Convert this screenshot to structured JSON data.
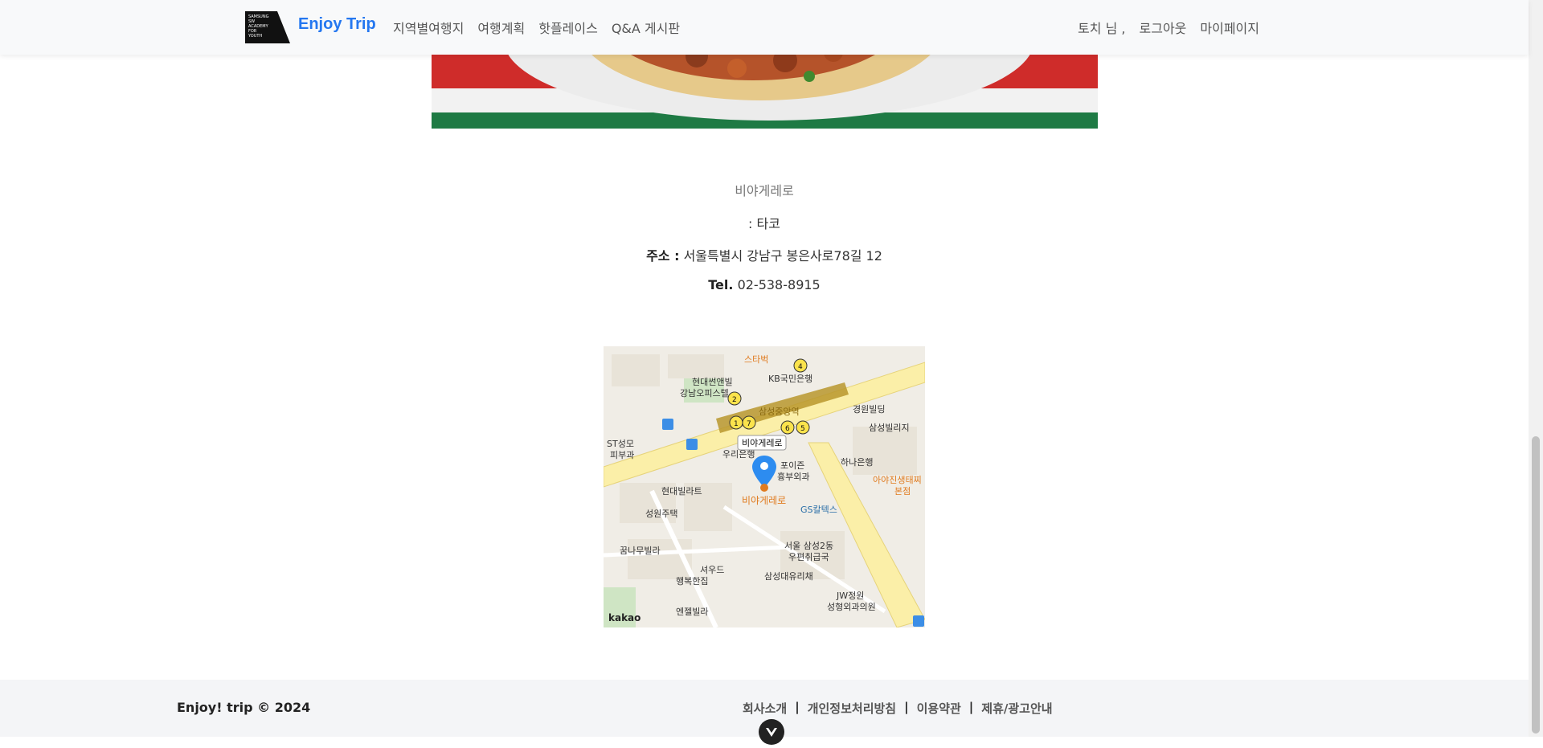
{
  "header": {
    "brand": "Enjoy Trip",
    "logo_text": "SAMSUNG SW ACADEMY FOR YOUTH",
    "nav": [
      "지역별여행지",
      "여행계획",
      "핫플레이스",
      "Q&A 게시판"
    ],
    "user_greeting": "토치 님 ,",
    "logout": "로그아웃",
    "mypage": "마이페이지"
  },
  "place": {
    "name": "비야게레로",
    "category": ": 타코",
    "address_label": "주소 :",
    "address": "서울특별시 강남구 봉은사로78길 12",
    "tel_label": "Tel.",
    "tel": "02-538-8915"
  },
  "map": {
    "marker_label": "비야게레로",
    "provider": "kakao",
    "labels": [
      "스타벅",
      "현대썬앤빌 강남오피스텔",
      "KB국민은행",
      "삼성중앙역",
      "경원빌딩",
      "삼성빌리지",
      "ST성모 피부과",
      "우리은행",
      "포이즌 흉부외과",
      "하나은행",
      "아야진생태찌 본점",
      "현대빌라트",
      "성원주택",
      "GS칼텍스",
      "꿈나무빌라",
      "서울 삼성2동 우편취급국",
      "셔우드",
      "행복한집",
      "삼성대유리채",
      "JW정원 성형외과의원",
      "엔젤빌라",
      "비야게레로"
    ]
  },
  "footer": {
    "copyright": "Enjoy! trip © 2024",
    "links": [
      "회사소개",
      "개인정보처리방침",
      "이용약관",
      "제휴/광고안내"
    ],
    "separator": "|"
  },
  "colors": {
    "brand": "#2477f0",
    "header_bg": "#f8f9fa",
    "footer_bg": "#f4f5f7",
    "map_marker": "#2d8cf0"
  }
}
